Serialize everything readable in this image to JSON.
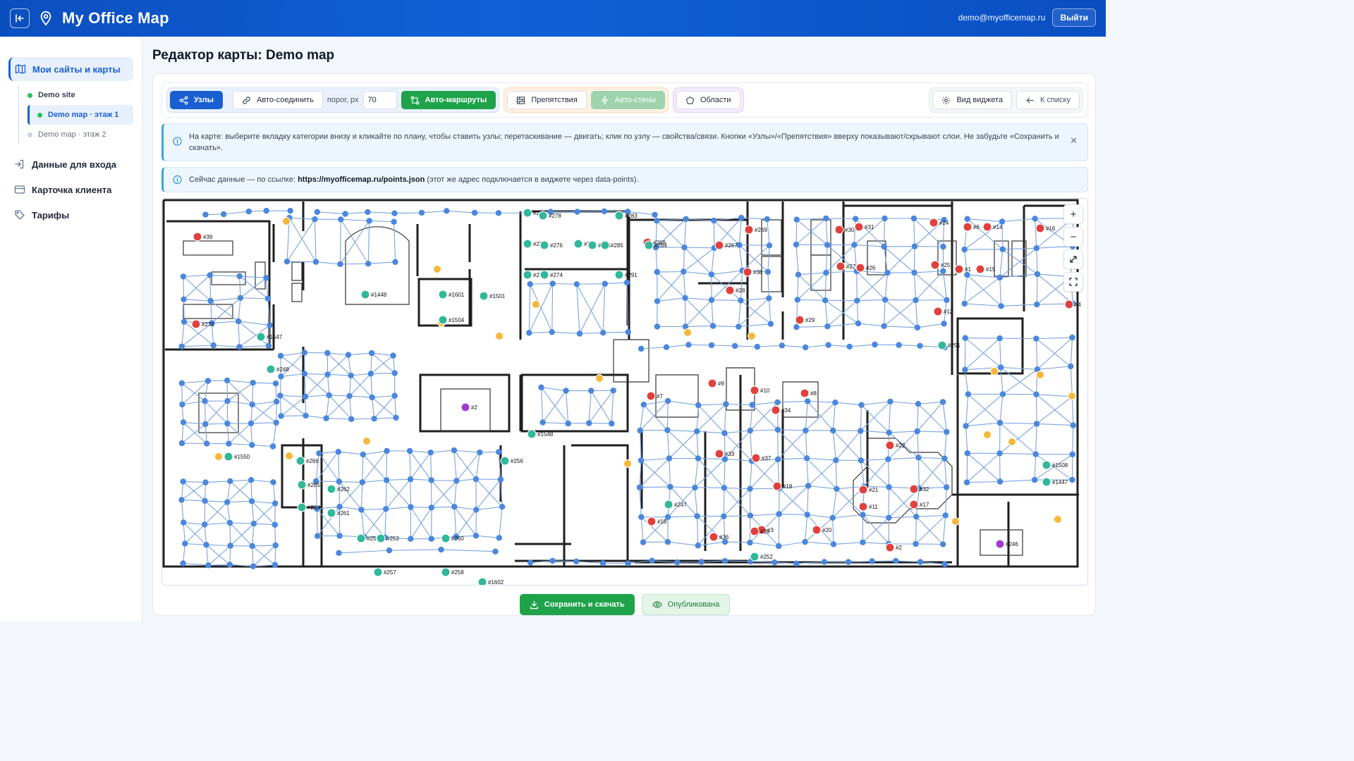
{
  "header": {
    "brand": "My Office Map",
    "user_email": "demo@myofficemap.ru",
    "logout": "Выйти"
  },
  "sidebar": {
    "my_sites": "Мои сайты и карты",
    "site": "Demo site",
    "floors": [
      "Demo map · этаж 1",
      "Demo map · этаж 2"
    ],
    "login_data": "Данные для входа",
    "client_card": "Карточка клиента",
    "tariffs": "Тарифы"
  },
  "page": {
    "title": "Редактор карты: Demo map"
  },
  "toolbar": {
    "nodes": "Узлы",
    "auto_connect": "Авто-соединить",
    "threshold_label": "порог, px",
    "threshold_value": "70",
    "auto_routes": "Авто-маршруты",
    "obstacles": "Препятствия",
    "auto_walls": "Авто-стены",
    "areas": "Области",
    "widget_view": "Вид виджета",
    "to_list": "К списку"
  },
  "alerts": {
    "help_text": "На карте: выберите вкладку категории внизу и кликайте по плану, чтобы ставить узлы; перетаскивание — двигать; клик по узлу — свойства/связи. Кнопки «Узлы»/«Препятствия» вверху показывают/скрывают слои. Не забудьте «Сохранить и скачать».",
    "data_prefix": "Сейчас данные — по ссылке: ",
    "data_url": "https://myofficemap.ru/points.json",
    "data_suffix": " (этот же адрес подключается в виджете через data-points)."
  },
  "map_controls": {
    "zoom_in": "+",
    "zoom_out": "−"
  },
  "map_labels": {
    "workplaces": [
      "#39",
      "#270",
      "#269",
      "#268",
      "#267",
      "#38",
      "#28",
      "#29",
      "#30",
      "#27",
      "#31",
      "#26",
      "#24",
      "#25",
      "#14",
      "#15",
      "#16",
      "#4",
      "#9",
      "#10",
      "#7",
      "#8",
      "#34",
      "#33",
      "#37",
      "#18",
      "#19",
      "#3",
      "#35",
      "#36",
      "#20",
      "#22",
      "#21",
      "#32",
      "#17",
      "#2",
      "#11",
      "#6",
      "#1",
      "#12"
    ],
    "meeting": [
      "#2",
      "#246"
    ],
    "devices": [
      "#279",
      "#278",
      "#277",
      "#276",
      "#275",
      "#274",
      "#287",
      "#286",
      "#285",
      "#284",
      "#283",
      "#291",
      "#1547",
      "#1548",
      "#266",
      "#265",
      "#264",
      "#262",
      "#261",
      "#254",
      "#253",
      "#260",
      "#258",
      "#257",
      "#256",
      "#251",
      "#252",
      "#1550",
      "#1602",
      "#1601",
      "#1504",
      "#1501",
      "#1508",
      "#1447",
      "#1448",
      "#248",
      "#247"
    ]
  },
  "footer": {
    "save": "Сохранить и скачать",
    "published": "Опубликована"
  }
}
